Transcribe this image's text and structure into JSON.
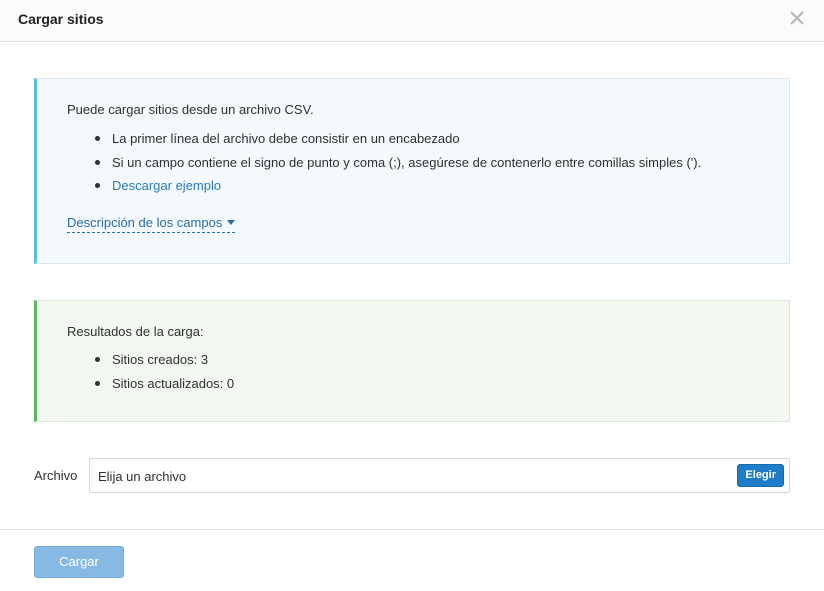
{
  "dialog": {
    "title": "Cargar sitios",
    "close_icon": "close-icon"
  },
  "info_panel": {
    "intro": "Puede cargar sitios desde un archivo CSV.",
    "bullets": [
      "La primer línea del archivo debe consistir en un encabezado",
      "Si un campo contiene el signo de punto y coma (;), asegúrese de contenerlo entre comillas simples (')."
    ],
    "download_link": "Descargar ejemplo",
    "fields_toggle": "Descripción de los campos",
    "toggle_icon": "caret-down-icon",
    "accent_color": "#5bc0de"
  },
  "results_panel": {
    "title": "Resultados de la carga:",
    "items": [
      "Sitios creados: 3",
      "Sitios actualizados: 0"
    ],
    "accent_color": "#5cb85c"
  },
  "file_input": {
    "label": "Archivo",
    "placeholder": "Elija un archivo",
    "choose_label": "Elegir"
  },
  "footer": {
    "submit_label": "Cargar"
  },
  "colors": {
    "link": "#2b7bb9",
    "primary_button": "#1d7dc8",
    "submit_button_disabled": "#86b9e3"
  }
}
